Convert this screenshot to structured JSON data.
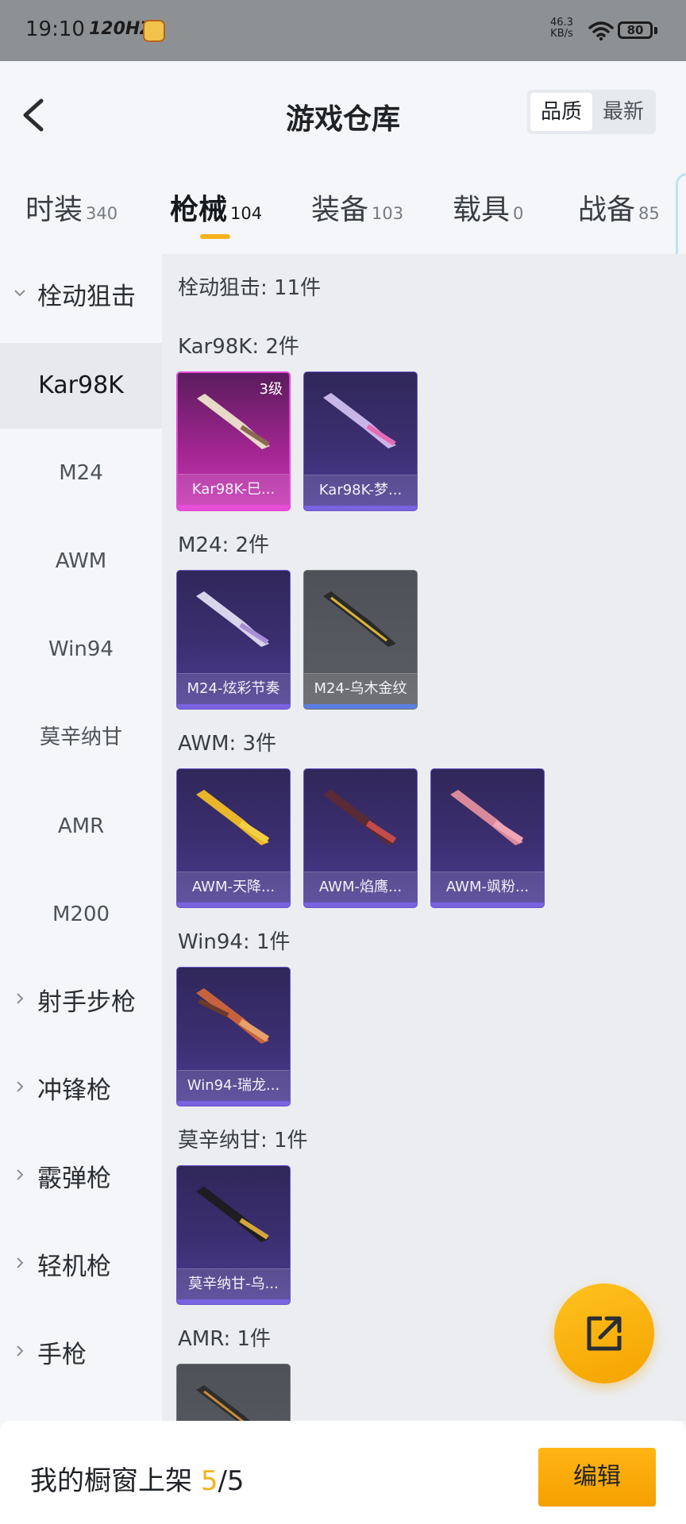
{
  "status_bar": {
    "time": "19:10",
    "refresh": "120HZ",
    "net_speed": "46.3",
    "net_unit": "KB/s",
    "battery": "80"
  },
  "header": {
    "title": "游戏仓库",
    "sort_options": [
      "品质",
      "最新"
    ]
  },
  "tabs": [
    {
      "label": "时装",
      "count": "340"
    },
    {
      "label": "枪械",
      "count": "104"
    },
    {
      "label": "装备",
      "count": "103"
    },
    {
      "label": "载具",
      "count": "0"
    },
    {
      "label": "战备",
      "count": "85"
    }
  ],
  "sidebar": {
    "expanded_group": "栓动狙击",
    "items": [
      "Kar98K",
      "M24",
      "AWM",
      "Win94",
      "莫辛纳甘",
      "AMR",
      "M200"
    ],
    "groups": [
      "射手步枪",
      "冲锋枪",
      "霰弹枪",
      "轻机枪",
      "手枪"
    ]
  },
  "content": {
    "category_title": "栓动狙击: 11件",
    "sections": [
      {
        "title": "Kar98K: 2件",
        "items": [
          {
            "name": "Kar98K-巳...",
            "level": "3级"
          },
          {
            "name": "Kar98K-梦..."
          }
        ]
      },
      {
        "title": "M24: 2件",
        "items": [
          {
            "name": "M24-炫彩节奏"
          },
          {
            "name": "M24-乌木金纹"
          }
        ]
      },
      {
        "title": "AWM: 3件",
        "items": [
          {
            "name": "AWM-天降..."
          },
          {
            "name": "AWM-焰鹰..."
          },
          {
            "name": "AWM-飒粉..."
          }
        ]
      },
      {
        "title": "Win94: 1件",
        "items": [
          {
            "name": "Win94-瑞龙..."
          }
        ]
      },
      {
        "title": "莫辛纳甘: 1件",
        "items": [
          {
            "name": "莫辛纳甘-乌..."
          }
        ]
      },
      {
        "title": "AMR: 1件",
        "items": [
          {
            "name": ""
          }
        ]
      }
    ]
  },
  "bottom": {
    "shelf_label": "我的橱窗上架",
    "shelf_count": "5",
    "shelf_total": "/5",
    "edit_label": "编辑"
  },
  "colors": {
    "accent": "#f6b21a",
    "card_purple": "#3c2f72",
    "card_magenta": "#c736b5",
    "card_grey": "#5b5e64"
  }
}
